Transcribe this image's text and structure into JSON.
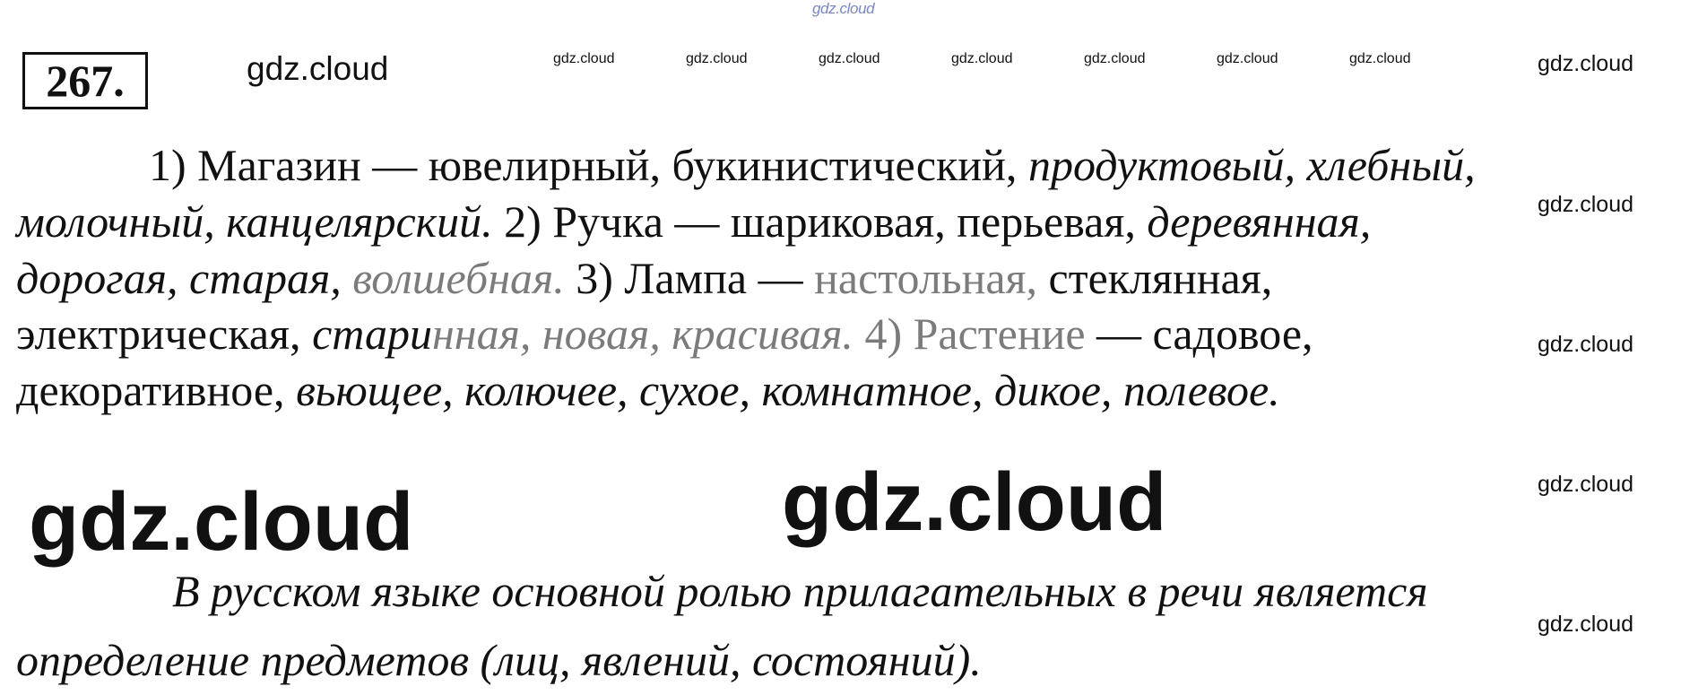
{
  "watermarks": {
    "top": "gdz.cloud",
    "header": "gdz.cloud",
    "small": [
      "gdz.cloud",
      "gdz.cloud",
      "gdz.cloud",
      "gdz.cloud",
      "gdz.cloud",
      "gdz.cloud",
      "gdz.cloud"
    ],
    "right": [
      "gdz.cloud",
      "gdz.cloud",
      "gdz.cloud",
      "gdz.cloud",
      "gdz.cloud"
    ],
    "big_left": "gdz.cloud",
    "big_center": "gdz.cloud"
  },
  "task_number": "267.",
  "answer": {
    "line1": {
      "regular": "1) Магазин — ювелирный, букинистический, ",
      "italic": "продуктовый, хлебный,"
    },
    "line2": {
      "italic": "молочный, канцелярский.",
      "regular": " 2) Ручка — шариковая, перьевая, ",
      "italic2": "деревянная,"
    },
    "line3": {
      "italic_a": "дорогая, старая, ",
      "italic_b": "волшебная.",
      "regular_a": " 3) Лампа — ",
      "regular_b": "настольная, ",
      "regular_c": "стеклянная,"
    },
    "line4": {
      "regular_a": "электрическая, ",
      "italic_a": "стари",
      "italic_b": "нная, новая, красивая.",
      "regular_b": " 4) Растение",
      "regular_c": " — садовое,"
    },
    "line5": {
      "regular": "декоративное, ",
      "italic": "вьющее, колючее, сухое, комнатное, дикое, полевое."
    }
  },
  "conclusion": {
    "line1": "В русском языке основной ролью прилагательных в речи является",
    "line2": "определение предметов (лиц, явлений, состояний)."
  }
}
